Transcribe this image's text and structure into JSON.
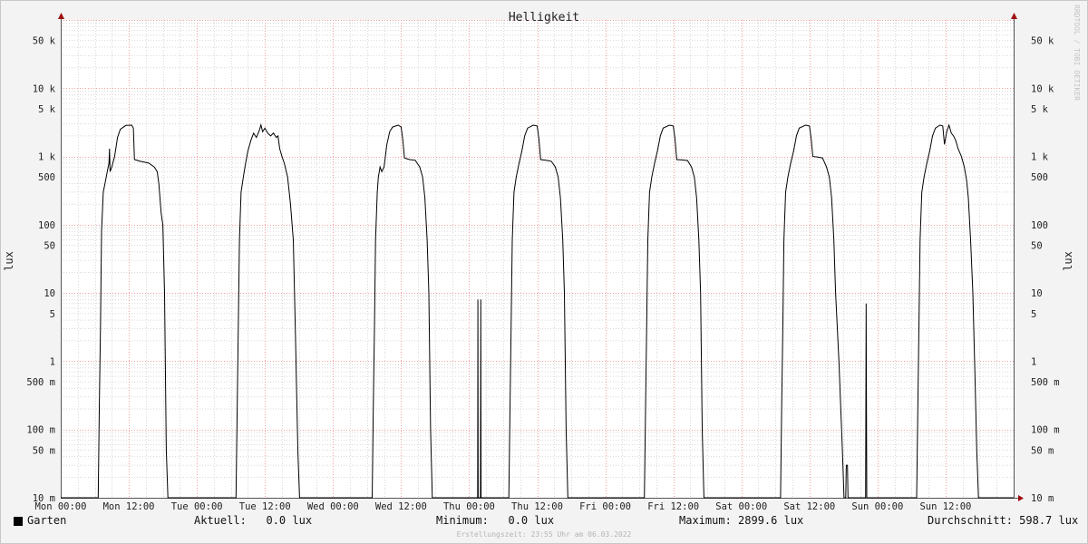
{
  "chart_data": {
    "type": "line",
    "title": "Helligkeit",
    "ylabel": "lux",
    "yscale": "log",
    "ylim": [
      0.01,
      100000
    ],
    "y_ticks": [
      {
        "v": 50000,
        "label": "50 k"
      },
      {
        "v": 10000,
        "label": "10 k"
      },
      {
        "v": 5000,
        "label": "5 k"
      },
      {
        "v": 1000,
        "label": "1 k"
      },
      {
        "v": 500,
        "label": "500"
      },
      {
        "v": 100,
        "label": "100"
      },
      {
        "v": 50,
        "label": "50"
      },
      {
        "v": 10,
        "label": "10"
      },
      {
        "v": 5,
        "label": "5"
      },
      {
        "v": 1,
        "label": "1"
      },
      {
        "v": 0.5,
        "label": "500 m"
      },
      {
        "v": 0.1,
        "label": "100 m"
      },
      {
        "v": 0.05,
        "label": "50 m"
      },
      {
        "v": 0.01,
        "label": "10 m"
      }
    ],
    "x_unit": "hours since Mon 00:00",
    "xlim": [
      0,
      168
    ],
    "x_ticks": [
      {
        "h": 0,
        "label": "Mon 00:00"
      },
      {
        "h": 12,
        "label": "Mon 12:00"
      },
      {
        "h": 24,
        "label": "Tue 00:00"
      },
      {
        "h": 36,
        "label": "Tue 12:00"
      },
      {
        "h": 48,
        "label": "Wed 00:00"
      },
      {
        "h": 60,
        "label": "Wed 12:00"
      },
      {
        "h": 72,
        "label": "Thu 00:00"
      },
      {
        "h": 84,
        "label": "Thu 12:00"
      },
      {
        "h": 96,
        "label": "Fri 00:00"
      },
      {
        "h": 108,
        "label": "Fri 12:00"
      },
      {
        "h": 120,
        "label": "Sat 00:00"
      },
      {
        "h": 132,
        "label": "Sat 12:00"
      },
      {
        "h": 144,
        "label": "Sun 00:00"
      },
      {
        "h": 156,
        "label": "Sun 12:00"
      }
    ],
    "grid": true,
    "series": [
      {
        "name": "Garten",
        "color": "#000000",
        "points": [
          [
            0,
            0.01
          ],
          [
            6.6,
            0.01
          ],
          [
            6.8,
            0.2
          ],
          [
            7.0,
            3
          ],
          [
            7.2,
            80
          ],
          [
            7.5,
            300
          ],
          [
            7.8,
            400
          ],
          [
            8.2,
            600
          ],
          [
            8.5,
            800
          ],
          [
            8.6,
            1300
          ],
          [
            8.7,
            600
          ],
          [
            9.0,
            700
          ],
          [
            9.5,
            1000
          ],
          [
            10.0,
            1900
          ],
          [
            10.5,
            2500
          ],
          [
            11.5,
            2850
          ],
          [
            12.5,
            2880
          ],
          [
            12.8,
            2600
          ],
          [
            13.0,
            900
          ],
          [
            14.0,
            850
          ],
          [
            15.5,
            800
          ],
          [
            16.5,
            700
          ],
          [
            17.0,
            600
          ],
          [
            17.3,
            400
          ],
          [
            17.7,
            150
          ],
          [
            18.0,
            100
          ],
          [
            18.3,
            10
          ],
          [
            18.6,
            0.05
          ],
          [
            18.9,
            0.01
          ],
          [
            30.9,
            0.01
          ],
          [
            31.1,
            0.2
          ],
          [
            31.3,
            3
          ],
          [
            31.5,
            60
          ],
          [
            31.8,
            300
          ],
          [
            32.2,
            500
          ],
          [
            32.6,
            800
          ],
          [
            33.0,
            1200
          ],
          [
            33.5,
            1700
          ],
          [
            34.0,
            2200
          ],
          [
            34.5,
            1900
          ],
          [
            35.0,
            2400
          ],
          [
            35.3,
            2900
          ],
          [
            35.6,
            2300
          ],
          [
            36.0,
            2600
          ],
          [
            36.5,
            2200
          ],
          [
            37.0,
            2000
          ],
          [
            37.5,
            2200
          ],
          [
            38.0,
            1900
          ],
          [
            38.3,
            2000
          ],
          [
            38.6,
            1300
          ],
          [
            39.0,
            1000
          ],
          [
            39.4,
            800
          ],
          [
            40.0,
            500
          ],
          [
            40.5,
            200
          ],
          [
            41.0,
            60
          ],
          [
            41.4,
            2
          ],
          [
            41.8,
            0.05
          ],
          [
            42.1,
            0.01
          ],
          [
            54.9,
            0.01
          ],
          [
            55.1,
            0.2
          ],
          [
            55.3,
            3
          ],
          [
            55.5,
            60
          ],
          [
            55.8,
            300
          ],
          [
            56.0,
            500
          ],
          [
            56.3,
            700
          ],
          [
            56.6,
            600
          ],
          [
            57.0,
            700
          ],
          [
            57.5,
            1500
          ],
          [
            58.0,
            2300
          ],
          [
            58.5,
            2700
          ],
          [
            59.5,
            2880
          ],
          [
            60.0,
            2700
          ],
          [
            60.3,
            1800
          ],
          [
            60.6,
            950
          ],
          [
            61.5,
            900
          ],
          [
            62.5,
            880
          ],
          [
            63.3,
            700
          ],
          [
            63.8,
            500
          ],
          [
            64.2,
            250
          ],
          [
            64.6,
            60
          ],
          [
            64.9,
            10
          ],
          [
            65.2,
            0.1
          ],
          [
            65.5,
            0.01
          ],
          [
            73.5,
            0.01
          ],
          [
            73.55,
            8
          ],
          [
            73.6,
            0.01
          ],
          [
            74.0,
            0.01
          ],
          [
            74.05,
            8
          ],
          [
            74.1,
            0.01
          ],
          [
            79.0,
            0.01
          ],
          [
            79.2,
            0.2
          ],
          [
            79.4,
            3
          ],
          [
            79.6,
            60
          ],
          [
            79.9,
            300
          ],
          [
            80.3,
            500
          ],
          [
            80.8,
            800
          ],
          [
            81.3,
            1200
          ],
          [
            81.8,
            2000
          ],
          [
            82.3,
            2600
          ],
          [
            83.3,
            2880
          ],
          [
            84.0,
            2800
          ],
          [
            84.3,
            1800
          ],
          [
            84.6,
            900
          ],
          [
            85.5,
            880
          ],
          [
            86.5,
            850
          ],
          [
            87.2,
            700
          ],
          [
            87.7,
            500
          ],
          [
            88.1,
            250
          ],
          [
            88.5,
            60
          ],
          [
            88.8,
            10
          ],
          [
            89.1,
            0.1
          ],
          [
            89.4,
            0.01
          ],
          [
            102.9,
            0.01
          ],
          [
            103.1,
            0.2
          ],
          [
            103.3,
            3
          ],
          [
            103.5,
            60
          ],
          [
            103.8,
            300
          ],
          [
            104.2,
            500
          ],
          [
            104.7,
            800
          ],
          [
            105.2,
            1200
          ],
          [
            105.7,
            2000
          ],
          [
            106.2,
            2600
          ],
          [
            107.3,
            2880
          ],
          [
            108.0,
            2800
          ],
          [
            108.3,
            1800
          ],
          [
            108.6,
            900
          ],
          [
            109.5,
            890
          ],
          [
            110.5,
            870
          ],
          [
            111.2,
            700
          ],
          [
            111.7,
            500
          ],
          [
            112.1,
            250
          ],
          [
            112.5,
            60
          ],
          [
            112.8,
            10
          ],
          [
            113.1,
            0.1
          ],
          [
            113.4,
            0.01
          ],
          [
            126.9,
            0.01
          ],
          [
            127.1,
            0.2
          ],
          [
            127.3,
            3
          ],
          [
            127.5,
            60
          ],
          [
            127.8,
            300
          ],
          [
            128.2,
            500
          ],
          [
            128.7,
            800
          ],
          [
            129.2,
            1200
          ],
          [
            129.7,
            2000
          ],
          [
            130.2,
            2600
          ],
          [
            131.3,
            2880
          ],
          [
            132.0,
            2800
          ],
          [
            132.3,
            1800
          ],
          [
            132.6,
            1000
          ],
          [
            133.5,
            980
          ],
          [
            134.3,
            950
          ],
          [
            135.0,
            700
          ],
          [
            135.5,
            500
          ],
          [
            135.9,
            250
          ],
          [
            136.3,
            60
          ],
          [
            136.6,
            10
          ],
          [
            137.2,
            1
          ],
          [
            137.8,
            0.05
          ],
          [
            138.1,
            0.01
          ],
          [
            138.4,
            0.01
          ],
          [
            138.5,
            0.03
          ],
          [
            138.7,
            0.03
          ],
          [
            138.8,
            0.01
          ],
          [
            141.9,
            0.01
          ],
          [
            142.0,
            7
          ],
          [
            142.1,
            0.01
          ],
          [
            150.9,
            0.01
          ],
          [
            151.1,
            0.2
          ],
          [
            151.3,
            3
          ],
          [
            151.5,
            60
          ],
          [
            151.8,
            300
          ],
          [
            152.2,
            500
          ],
          [
            152.7,
            800
          ],
          [
            153.2,
            1200
          ],
          [
            153.7,
            2000
          ],
          [
            154.2,
            2600
          ],
          [
            155.0,
            2880
          ],
          [
            155.5,
            2800
          ],
          [
            155.8,
            1500
          ],
          [
            156.2,
            2300
          ],
          [
            156.6,
            2880
          ],
          [
            157.0,
            2200
          ],
          [
            157.4,
            2000
          ],
          [
            157.8,
            1700
          ],
          [
            158.2,
            1300
          ],
          [
            158.8,
            1000
          ],
          [
            159.3,
            700
          ],
          [
            159.7,
            450
          ],
          [
            160.0,
            250
          ],
          [
            160.4,
            60
          ],
          [
            160.8,
            10
          ],
          [
            161.2,
            0.5
          ],
          [
            161.5,
            0.05
          ],
          [
            161.8,
            0.01
          ],
          [
            168,
            0.01
          ]
        ]
      }
    ]
  },
  "legend": {
    "series_name": "Garten",
    "aktuell": "Aktuell:   0.0 lux",
    "minimum": "Minimum:   0.0 lux",
    "maximum": "Maximum: 2899.6 lux",
    "durchschnitt": "Durchschnitt: 598.7 lux"
  },
  "footer": {
    "created": "Erstellungszeit: 23:55 Uhr am 06.03.2022",
    "credit": "RRDTOOL / TOBI OETIKER"
  }
}
